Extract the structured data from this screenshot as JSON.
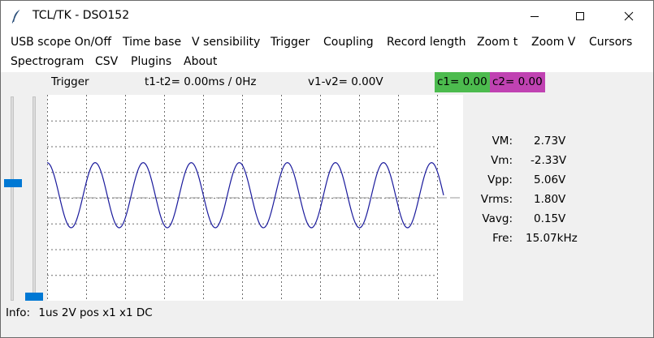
{
  "window": {
    "title": "TCL/TK - DSO152",
    "controls": {
      "minimize": "minimize-icon",
      "maximize": "maximize-icon",
      "close": "close-icon"
    }
  },
  "menu": {
    "row1": [
      "USB scope On/Off",
      "Time base",
      "V sensibility",
      "Trigger",
      "Coupling",
      "Record length",
      "Zoom t",
      "Zoom V",
      "Cursors"
    ],
    "row2": [
      "Spectrogram",
      "CSV",
      "Plugins",
      "About"
    ]
  },
  "status": {
    "trigger": "Trigger",
    "t_cursor": "t1-t2= 0.00ms / 0Hz",
    "v_cursor": "v1-v2= 0.00V",
    "c1": "c1= 0.00",
    "c2": "c2= 0.00",
    "c1_color": "#4cbb4e",
    "c2_color": "#c042b2"
  },
  "sliders": {
    "left_level": 0.58,
    "right_level": 0.0
  },
  "measurements": [
    {
      "label": "VM:",
      "value": "2.73V"
    },
    {
      "label": "Vm:",
      "value": "-2.33V"
    },
    {
      "label": "Vpp:",
      "value": "5.06V"
    },
    {
      "label": "Vrms:",
      "value": "1.80V"
    },
    {
      "label": "Vavg:",
      "value": "0.15V"
    },
    {
      "label": "Fre:",
      "value": "15.07kHz"
    }
  ],
  "info": {
    "label": "Info:",
    "value": "1us 2V pos x1 x1 DC"
  },
  "chart_data": {
    "type": "line",
    "grid": true,
    "x_divisions": 10,
    "y_divisions": 8,
    "series": [
      {
        "color": "#1a1a9c",
        "waveform": "sine",
        "max": 2.73,
        "min": -2.33,
        "frequency_khz": 15.07,
        "cycles_shown": 8.25
      }
    ],
    "trigger_level_color": "#999999"
  }
}
